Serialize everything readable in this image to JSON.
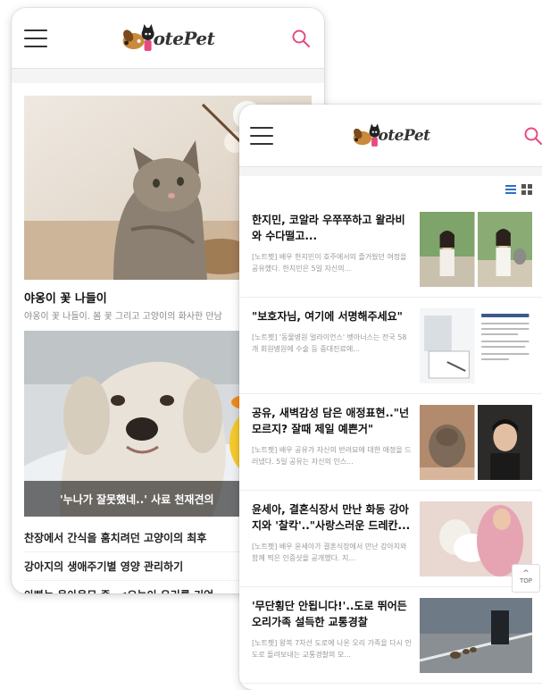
{
  "brand": {
    "logo_text": "otePet",
    "accent_color": "#e84a7f"
  },
  "back_screen": {
    "feed": [
      {
        "title": "야옹이 꽃 나들이",
        "excerpt": "야옹이 꽃 나들이. 봄 꽃 그리고 고양이의 화사한 만남"
      }
    ],
    "dog_card": {
      "caption": "'누나가 잘못했네..' 사료 천재견의"
    },
    "headlines": [
      "찬장에서 간식을 훔치려던 고양이의 최후",
      "강아지의 생애주기별 영양 관리하기",
      "아빠는 육아육묘 중, <오늘이 우리를 기억"
    ]
  },
  "front_screen": {
    "articles": [
      {
        "title": "한지민, 코알라 우쭈쭈하고 왈라비와 수다떨고...",
        "excerpt": "[노트펫] 배우 한지민이 호주에서의 즐거웠던 여정을 공유했다. 한지민은 5일 자신의..."
      },
      {
        "title": "\"보호자님, 여기에 서명해주세요\"",
        "excerpt": "[노트펫] '동물병원 얼라이언스' 벳아너스는 전국 58개 회원병원에 수술 등 중대진료에..."
      },
      {
        "title": "공유, 새벽감성 담은 애정표현..\"넌 모르지? 잘때 제일 예쁜거\"",
        "excerpt": "[노트펫] 배우 공유가 자신의 반려묘에 대한 애정을 드러냈다. 5일 공유는 자신의 인스..."
      },
      {
        "title": "윤세아, 결혼식장서 만난 화동 강아지와 '찰칵'..\"사랑스러운 드레칸...",
        "excerpt": "[노트펫] 배우 윤세아가 결혼식장에서 만난 강아지와 함께 찍은 인증샷을 공개했다. 지..."
      },
      {
        "title": "'무단횡단 안됩니다!'..도로 뛰어든 오리가족 설득한 교통경찰",
        "excerpt": "[노트펫] 왕복 7차선 도로에 나온 오리 가족을 다시 인도로 돌려보내는 교통경찰의 모..."
      }
    ],
    "top_button": "TOP"
  },
  "icons": {
    "menu": "hamburger-icon",
    "search": "search-icon",
    "list_view": "list-view-icon",
    "grid_view": "grid-view-icon"
  }
}
